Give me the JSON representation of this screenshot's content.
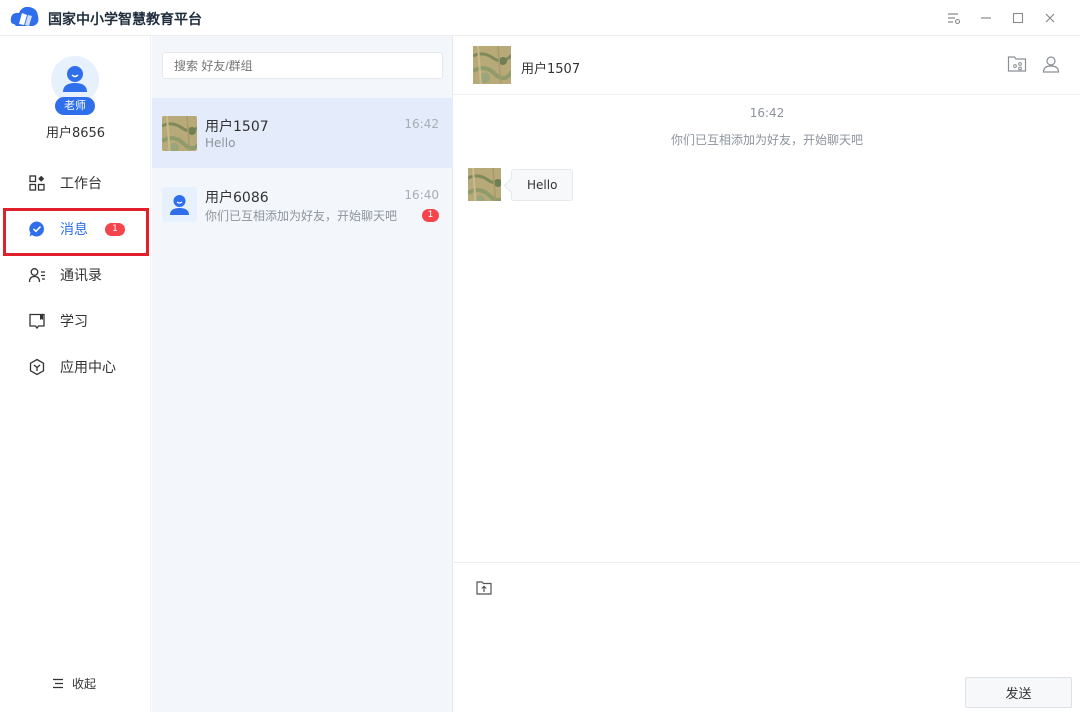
{
  "app": {
    "title": "国家中小学智慧教育平台",
    "icons": {
      "logo": "cloud-book-logo",
      "settings": "filter-settings-icon",
      "minimize": "minimize-icon",
      "maximize": "maximize-icon",
      "close": "close-icon"
    }
  },
  "profile": {
    "role_badge": "老师",
    "username": "用户8656"
  },
  "nav": {
    "items": [
      {
        "label": "工作台",
        "icon": "grid-icon"
      },
      {
        "label": "消息",
        "icon": "message-icon",
        "badge": "1"
      },
      {
        "label": "通讯录",
        "icon": "contacts-icon"
      },
      {
        "label": "学习",
        "icon": "book-icon"
      },
      {
        "label": "应用中心",
        "icon": "app-center-icon"
      }
    ],
    "collapse_label": "收起"
  },
  "chatlist": {
    "search_placeholder": "搜索 好友/群组",
    "conversations": [
      {
        "name": "用户1507",
        "last_message": "Hello",
        "time": "16:42"
      },
      {
        "name": "用户6086",
        "last_message": "你们已互相添加为好友，开始聊天吧",
        "time": "16:40",
        "badge": "1"
      }
    ]
  },
  "chat": {
    "header_name": "用户1507",
    "time_divider": "16:42",
    "system_message": "你们已互相添加为好友，开始聊天吧",
    "messages": [
      {
        "text": "Hello"
      }
    ],
    "send_label": "发送"
  },
  "colors": {
    "accent": "#2f6fec",
    "badge": "#f5454c",
    "highlight": "#e2202c",
    "list_bg": "#f3f7fc"
  }
}
